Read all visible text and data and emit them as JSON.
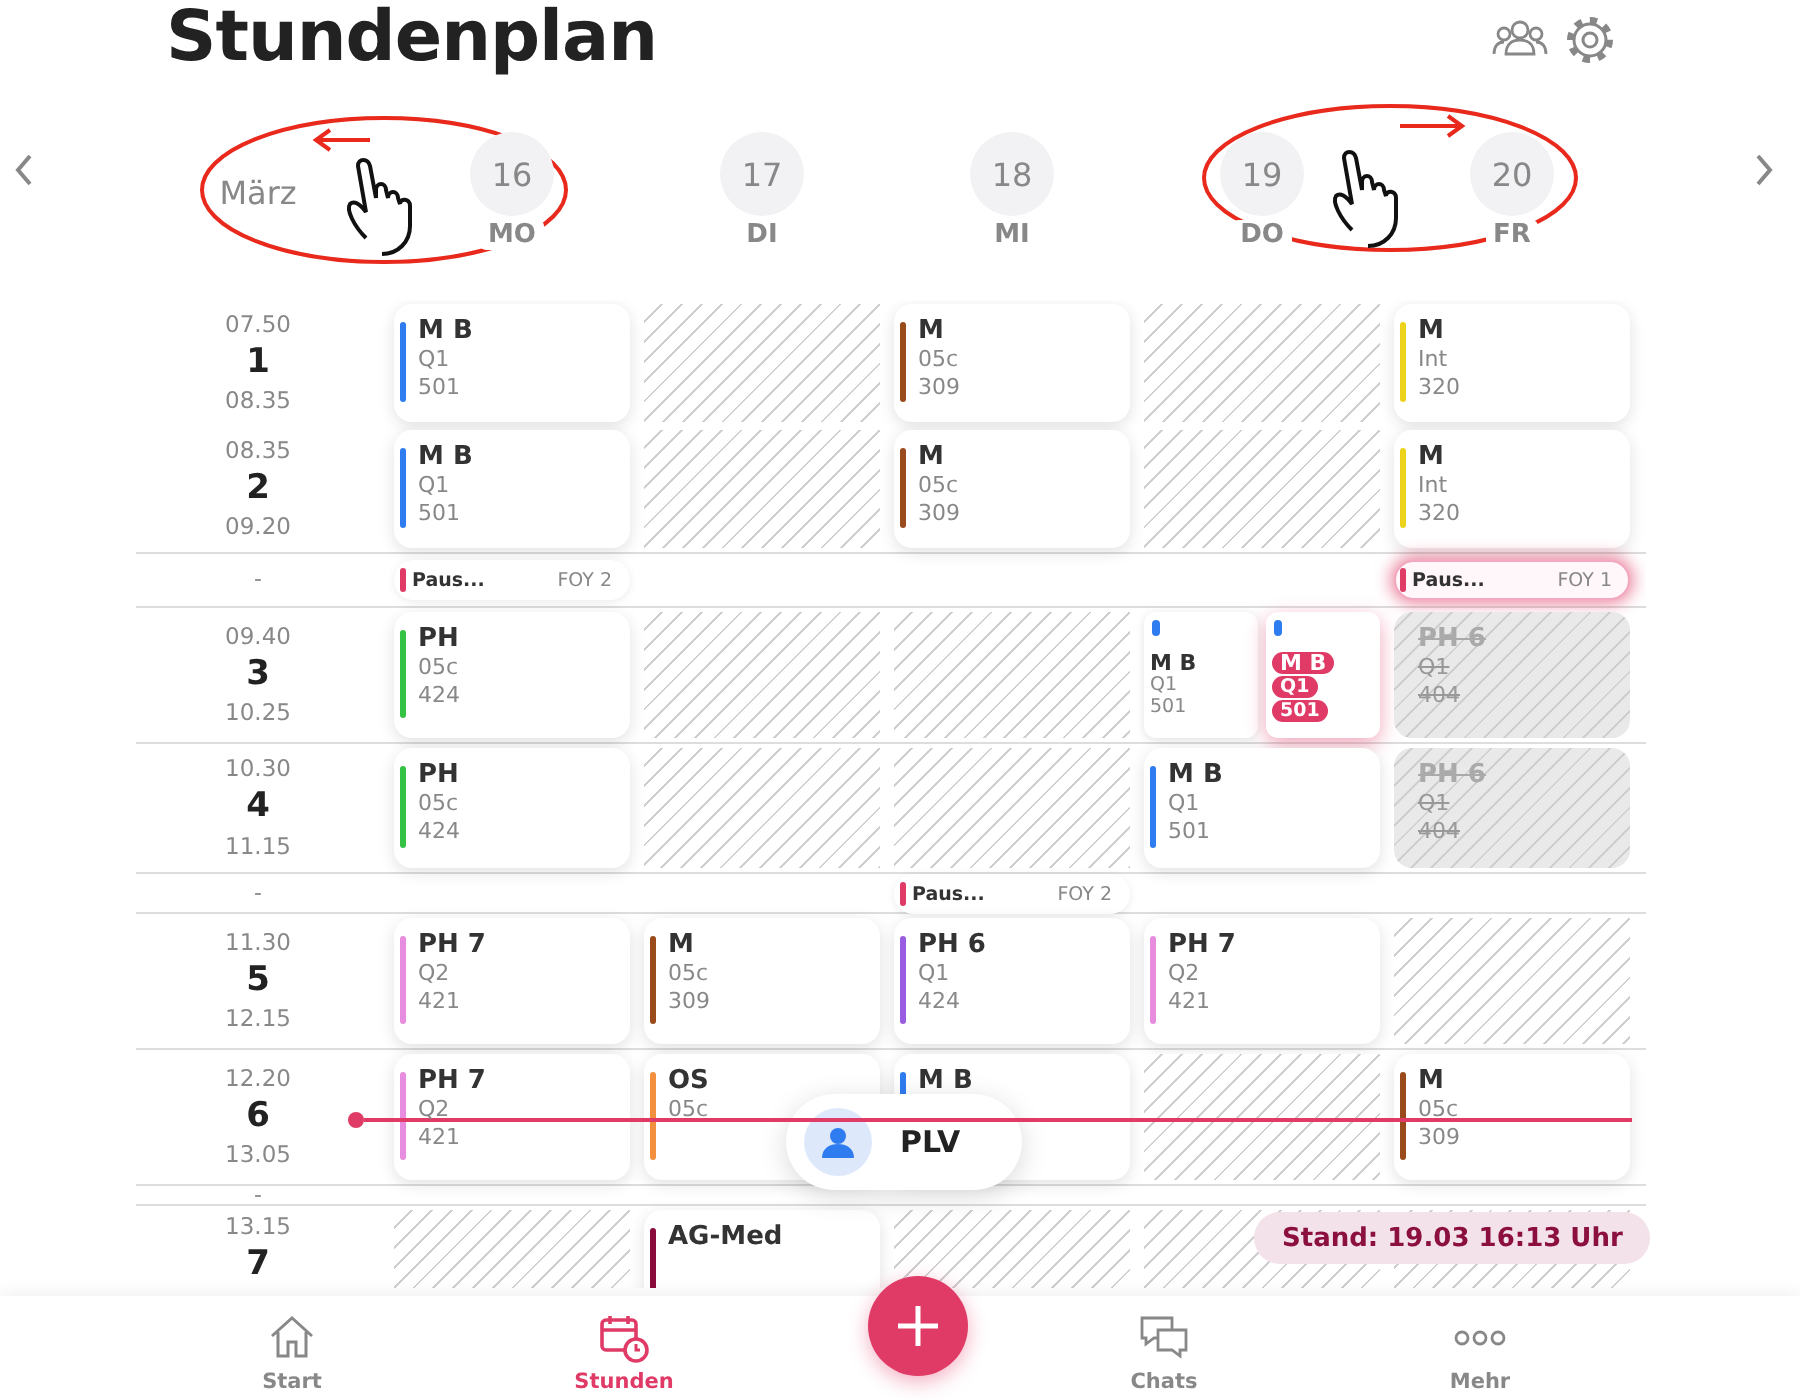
{
  "header": {
    "title": "Stundenplan"
  },
  "week": {
    "month": "März",
    "days": [
      {
        "date": "16",
        "weekday": "MO"
      },
      {
        "date": "17",
        "weekday": "DI"
      },
      {
        "date": "18",
        "weekday": "MI"
      },
      {
        "date": "19",
        "weekday": "DO"
      },
      {
        "date": "20",
        "weekday": "FR"
      }
    ]
  },
  "periods": [
    {
      "kind": "lesson",
      "start": "07.50",
      "number": "1",
      "end": "08.35",
      "now": false,
      "cells": [
        {
          "kind": "lesson",
          "subject": "M B",
          "class": "Q1",
          "room": "501",
          "color": "#2f7cf0"
        },
        {
          "kind": "free"
        },
        {
          "kind": "lesson",
          "subject": "M",
          "class": "05c",
          "room": "309",
          "color": "#9a4b1c"
        },
        {
          "kind": "free"
        },
        {
          "kind": "lesson",
          "subject": "M",
          "class": "Int",
          "room": "320",
          "color": "#ecd21a"
        }
      ]
    },
    {
      "kind": "lesson",
      "start": "08.35",
      "number": "2",
      "end": "09.20",
      "now": false,
      "cells": [
        {
          "kind": "lesson",
          "subject": "M B",
          "class": "Q1",
          "room": "501",
          "color": "#2f7cf0"
        },
        {
          "kind": "free"
        },
        {
          "kind": "lesson",
          "subject": "M",
          "class": "05c",
          "room": "309",
          "color": "#9a4b1c"
        },
        {
          "kind": "free"
        },
        {
          "kind": "lesson",
          "subject": "M",
          "class": "Int",
          "room": "320",
          "color": "#ecd21a"
        }
      ]
    },
    {
      "kind": "pause",
      "label": "-",
      "now": false,
      "cells": [
        {
          "kind": "pause",
          "title": "Paus...",
          "room": "FOY 2",
          "highlighted": false
        },
        {
          "kind": "blank"
        },
        {
          "kind": "blank"
        },
        {
          "kind": "blank"
        },
        {
          "kind": "pause",
          "title": "Paus...",
          "room": "FOY 1",
          "highlighted": true
        }
      ]
    },
    {
      "kind": "lesson",
      "start": "09.40",
      "number": "3",
      "end": "10.25",
      "now": false,
      "cells": [
        {
          "kind": "lesson",
          "subject": "PH",
          "class": "05c",
          "room": "424",
          "color": "#34c244"
        },
        {
          "kind": "free"
        },
        {
          "kind": "free"
        },
        {
          "kind": "split",
          "items": [
            {
              "subject": "M B",
              "class": "Q1",
              "room": "501",
              "color": "#2f7cf0",
              "highlighted": false
            },
            {
              "subject": "M B",
              "class": "Q1",
              "room": "501",
              "color": "#2f7cf0",
              "highlighted": true
            }
          ]
        },
        {
          "kind": "cancelled",
          "subject": "PH 6",
          "class": "Q1",
          "room": "404"
        }
      ]
    },
    {
      "kind": "lesson",
      "start": "10.30",
      "number": "4",
      "end": "11.15",
      "now": false,
      "cells": [
        {
          "kind": "lesson",
          "subject": "PH",
          "class": "05c",
          "room": "424",
          "color": "#34c244"
        },
        {
          "kind": "free"
        },
        {
          "kind": "free"
        },
        {
          "kind": "lesson",
          "subject": "M B",
          "class": "Q1",
          "room": "501",
          "color": "#2f7cf0"
        },
        {
          "kind": "cancelled",
          "subject": "PH 6",
          "class": "Q1",
          "room": "404"
        }
      ]
    },
    {
      "kind": "pause",
      "label": "-",
      "now": false,
      "cells": [
        {
          "kind": "blank"
        },
        {
          "kind": "blank"
        },
        {
          "kind": "pause",
          "title": "Paus...",
          "room": "FOY 2",
          "highlighted": false
        },
        {
          "kind": "blank"
        },
        {
          "kind": "blank"
        }
      ]
    },
    {
      "kind": "lesson",
      "start": "11.30",
      "number": "5",
      "end": "12.15",
      "now": false,
      "cells": [
        {
          "kind": "lesson",
          "subject": "PH 7",
          "class": "Q2",
          "room": "421",
          "color": "#e88ce0"
        },
        {
          "kind": "lesson",
          "subject": "M",
          "class": "05c",
          "room": "309",
          "color": "#9a4b1c"
        },
        {
          "kind": "lesson",
          "subject": "PH 6",
          "class": "Q1",
          "room": "424",
          "color": "#9a5ce0"
        },
        {
          "kind": "lesson",
          "subject": "PH 7",
          "class": "Q2",
          "room": "421",
          "color": "#e88ce0"
        },
        {
          "kind": "free"
        }
      ]
    },
    {
      "kind": "lesson",
      "start": "12.20",
      "number": "6",
      "end": "13.05",
      "now": true,
      "cells": [
        {
          "kind": "lesson",
          "subject": "PH 7",
          "class": "Q2",
          "room": "421",
          "color": "#e88ce0"
        },
        {
          "kind": "lesson",
          "subject": "OS",
          "class": "05c",
          "color": "#f39040"
        },
        {
          "kind": "lesson",
          "subject": "M B",
          "color": "#2f7cf0"
        },
        {
          "kind": "free"
        },
        {
          "kind": "lesson",
          "subject": "M",
          "class": "05c",
          "room": "309",
          "color": "#9a4b1c"
        }
      ]
    },
    {
      "kind": "pause",
      "label": "-",
      "now": false,
      "cells": [
        {
          "kind": "blank"
        },
        {
          "kind": "blank"
        },
        {
          "kind": "blank"
        },
        {
          "kind": "blank"
        },
        {
          "kind": "blank"
        }
      ]
    },
    {
      "kind": "lesson",
      "start": "13.15",
      "number": "7",
      "now": false,
      "cells": [
        {
          "kind": "free"
        },
        {
          "kind": "lesson",
          "subject": "AG-Med",
          "color": "#8a0c3c"
        },
        {
          "kind": "free"
        },
        {
          "kind": "free"
        },
        {
          "kind": "free"
        }
      ]
    }
  ],
  "popup": {
    "label": "PLV"
  },
  "status": "Stand: 19.03 16:13 Uhr",
  "nav": [
    {
      "label": "Start",
      "selected": false
    },
    {
      "label": "Stunden",
      "selected": true
    },
    {
      "label": "Chats",
      "selected": false
    },
    {
      "label": "Mehr",
      "selected": false
    }
  ]
}
